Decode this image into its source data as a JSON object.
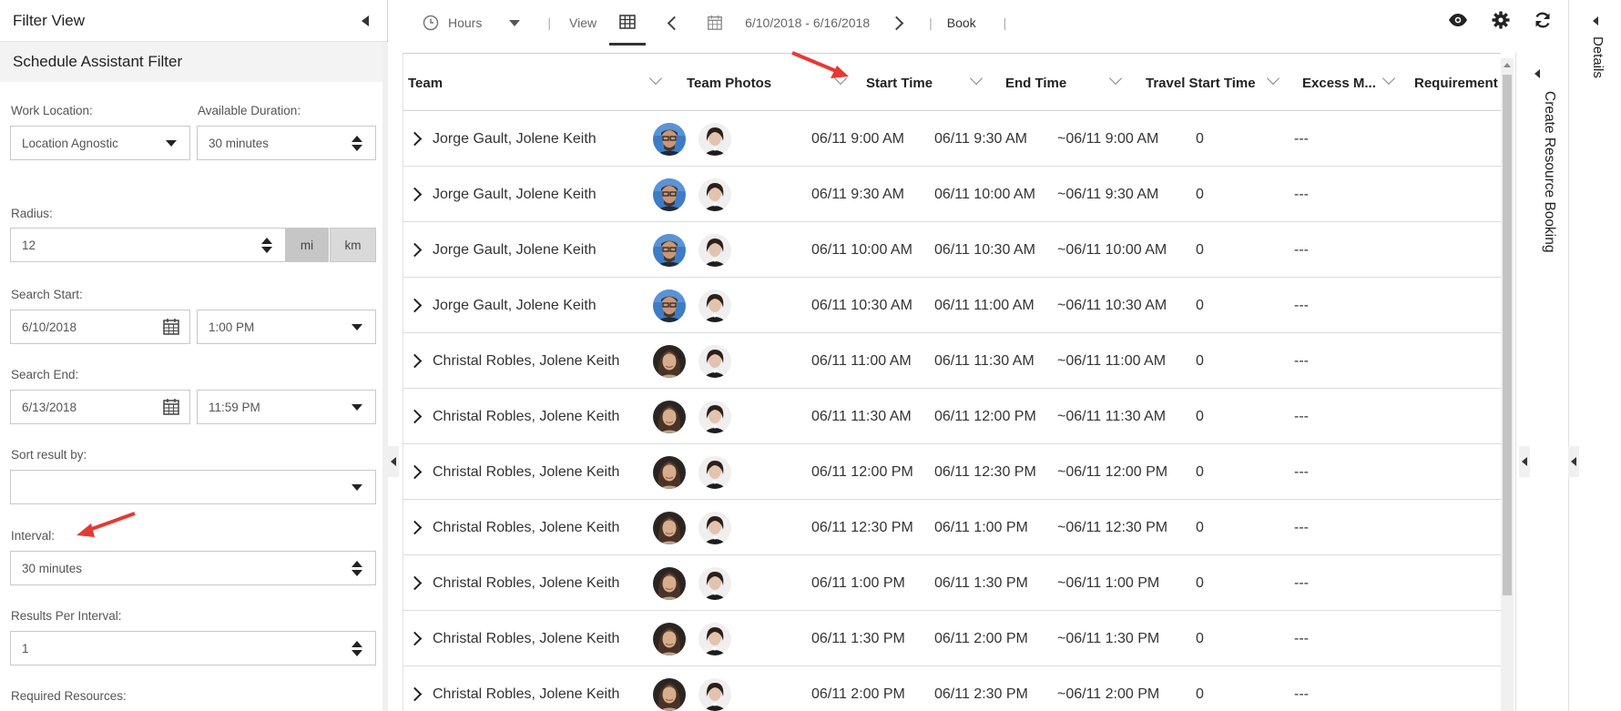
{
  "filter_panel": {
    "title": "Filter View",
    "subtitle": "Schedule Assistant Filter",
    "work_location": {
      "label": "Work Location:",
      "value": "Location Agnostic"
    },
    "available_duration": {
      "label": "Available Duration:",
      "value": "30 minutes"
    },
    "radius": {
      "label": "Radius:",
      "value": "12",
      "unit_mi": "mi",
      "unit_km": "km",
      "selected_unit": "mi"
    },
    "search_start": {
      "label": "Search Start:",
      "date": "6/10/2018",
      "time": "1:00 PM"
    },
    "search_end": {
      "label": "Search End:",
      "date": "6/13/2018",
      "time": "11:59 PM"
    },
    "sort_result_by": {
      "label": "Sort result by:",
      "value": ""
    },
    "interval": {
      "label": "Interval:",
      "value": "30 minutes"
    },
    "results_per_interval": {
      "label": "Results Per Interval:",
      "value": "1"
    },
    "required_resources": {
      "label": "Required Resources:"
    }
  },
  "toolbar": {
    "hours_label": "Hours",
    "view_label": "View",
    "date_range": "6/10/2018 - 6/16/2018",
    "book_label": "Book"
  },
  "grid": {
    "columns": [
      "Team",
      "Team Photos",
      "Start Time",
      "End Time",
      "Travel Start Time",
      "Excess M...",
      "Requirement"
    ],
    "rows": [
      {
        "team": "Jorge Gault, Jolene Keith",
        "photos": [
          "jorge",
          "jolene"
        ],
        "start": "06/11 9:00 AM",
        "end": "06/11 9:30 AM",
        "travel": "~06/11 9:00 AM",
        "excess": "0",
        "requirement": "---"
      },
      {
        "team": "Jorge Gault, Jolene Keith",
        "photos": [
          "jorge",
          "jolene"
        ],
        "start": "06/11 9:30 AM",
        "end": "06/11 10:00 AM",
        "travel": "~06/11 9:30 AM",
        "excess": "0",
        "requirement": "---"
      },
      {
        "team": "Jorge Gault, Jolene Keith",
        "photos": [
          "jorge",
          "jolene"
        ],
        "start": "06/11 10:00 AM",
        "end": "06/11 10:30 AM",
        "travel": "~06/11 10:00 AM",
        "excess": "0",
        "requirement": "---"
      },
      {
        "team": "Jorge Gault, Jolene Keith",
        "photos": [
          "jorge",
          "jolene"
        ],
        "start": "06/11 10:30 AM",
        "end": "06/11 11:00 AM",
        "travel": "~06/11 10:30 AM",
        "excess": "0",
        "requirement": "---"
      },
      {
        "team": "Christal Robles, Jolene Keith",
        "photos": [
          "christal",
          "jolene"
        ],
        "start": "06/11 11:00 AM",
        "end": "06/11 11:30 AM",
        "travel": "~06/11 11:00 AM",
        "excess": "0",
        "requirement": "---"
      },
      {
        "team": "Christal Robles, Jolene Keith",
        "photos": [
          "christal",
          "jolene"
        ],
        "start": "06/11 11:30 AM",
        "end": "06/11 12:00 PM",
        "travel": "~06/11 11:30 AM",
        "excess": "0",
        "requirement": "---"
      },
      {
        "team": "Christal Robles, Jolene Keith",
        "photos": [
          "christal",
          "jolene"
        ],
        "start": "06/11 12:00 PM",
        "end": "06/11 12:30 PM",
        "travel": "~06/11 12:00 PM",
        "excess": "0",
        "requirement": "---"
      },
      {
        "team": "Christal Robles, Jolene Keith",
        "photos": [
          "christal",
          "jolene"
        ],
        "start": "06/11 12:30 PM",
        "end": "06/11 1:00 PM",
        "travel": "~06/11 12:30 PM",
        "excess": "0",
        "requirement": "---"
      },
      {
        "team": "Christal Robles, Jolene Keith",
        "photos": [
          "christal",
          "jolene"
        ],
        "start": "06/11 1:00 PM",
        "end": "06/11 1:30 PM",
        "travel": "~06/11 1:00 PM",
        "excess": "0",
        "requirement": "---"
      },
      {
        "team": "Christal Robles, Jolene Keith",
        "photos": [
          "christal",
          "jolene"
        ],
        "start": "06/11 1:30 PM",
        "end": "06/11 2:00 PM",
        "travel": "~06/11 1:30 PM",
        "excess": "0",
        "requirement": "---"
      },
      {
        "team": "Christal Robles, Jolene Keith",
        "photos": [
          "christal",
          "jolene"
        ],
        "start": "06/11 2:00 PM",
        "end": "06/11 2:30 PM",
        "travel": "~06/11 2:00 PM",
        "excess": "0",
        "requirement": "---"
      }
    ]
  },
  "side_panels": {
    "create_resource_booking": "Create Resource Booking",
    "details": "Details"
  },
  "colors": {
    "annotation_arrow": "#e53935",
    "border": "#c8c8c8",
    "subheader_bg": "#f3f3f3"
  },
  "icons": [
    "clock-icon",
    "grid-view-icon",
    "calendar-icon",
    "eye-icon",
    "gear-icon",
    "refresh-icon",
    "chevron-left-icon",
    "chevron-right-icon"
  ]
}
